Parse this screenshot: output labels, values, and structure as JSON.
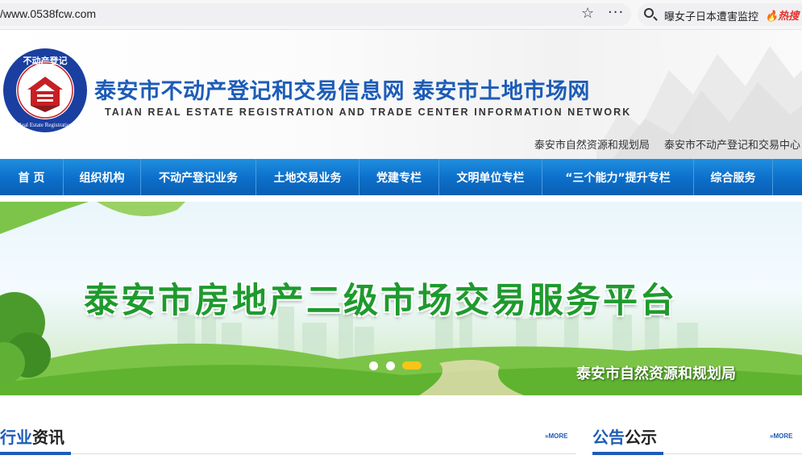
{
  "browser": {
    "url": "/www.0538fcw.com",
    "search_text": "曝女子日本遭害监控",
    "hot_label": "🔥热搜"
  },
  "header": {
    "logo_ring_text": "不动产登记",
    "logo_bottom_text": "Real Estate Registration",
    "title_cn": "泰安市不动产登记和交易信息网  泰安市土地市场网",
    "title_en": "TAIAN REAL ESTATE REGISTRATION AND TRADE CENTER INFORMATION NETWORK",
    "links": [
      "泰安市自然资源和规划局",
      "泰安市不动产登记和交易中心"
    ]
  },
  "nav": {
    "items": [
      "首  页",
      "组织机构",
      "不动产登记业务",
      "土地交易业务",
      "党建专栏",
      "文明单位专栏",
      "“三个能力”提升专栏",
      "综合服务"
    ]
  },
  "banner": {
    "title": "泰安市房地产二级市场交易服务平台",
    "subtitle": "泰安市自然资源和规划局",
    "slide_count": 3,
    "active_slide": 3
  },
  "sections": {
    "news": {
      "title_hl": "行业",
      "title_rest": "资讯",
      "more": "»MORE"
    },
    "notice": {
      "title_hl": "公告",
      "title_rest": "公示",
      "more": "»MORE"
    }
  },
  "colors": {
    "brand_blue": "#1d5cb8",
    "nav_blue": "#0c6ec9",
    "banner_green": "#1e9a2e",
    "slider_active": "#f5c518"
  }
}
